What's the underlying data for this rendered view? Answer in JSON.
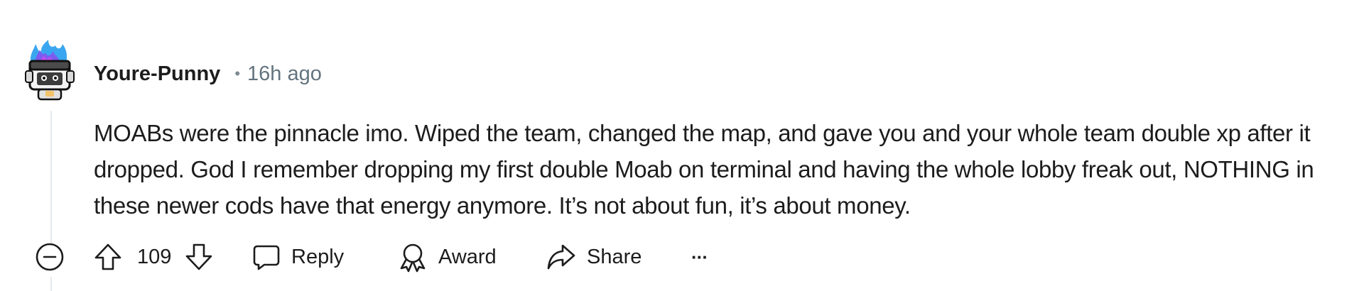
{
  "comment": {
    "author": "Youre-Punny",
    "separator": "•",
    "timestamp": "16h ago",
    "body": "MOABs were the pinnacle imo. Wiped the team, changed the map, and gave you and your whole team double xp after it dropped. God I remember dropping my first double Moab on terminal and having the whole lobby freak out, NOTHING in these newer cods have that energy anymore. It’s not about fun, it’s about money.",
    "avatar_icon": "snoo-avatar-icon"
  },
  "actions": {
    "collapse_icon": "collapse-minus-icon",
    "upvote_icon": "upvote-arrow-icon",
    "score": "109",
    "downvote_icon": "downvote-arrow-icon",
    "reply_label": "Reply",
    "award_label": "Award",
    "share_label": "Share",
    "more_label": "···"
  },
  "colors": {
    "text": "#1c1c1c",
    "meta": "#63747f",
    "thread_line": "#e5ebee",
    "avatar_flame": "#3da9f5"
  }
}
